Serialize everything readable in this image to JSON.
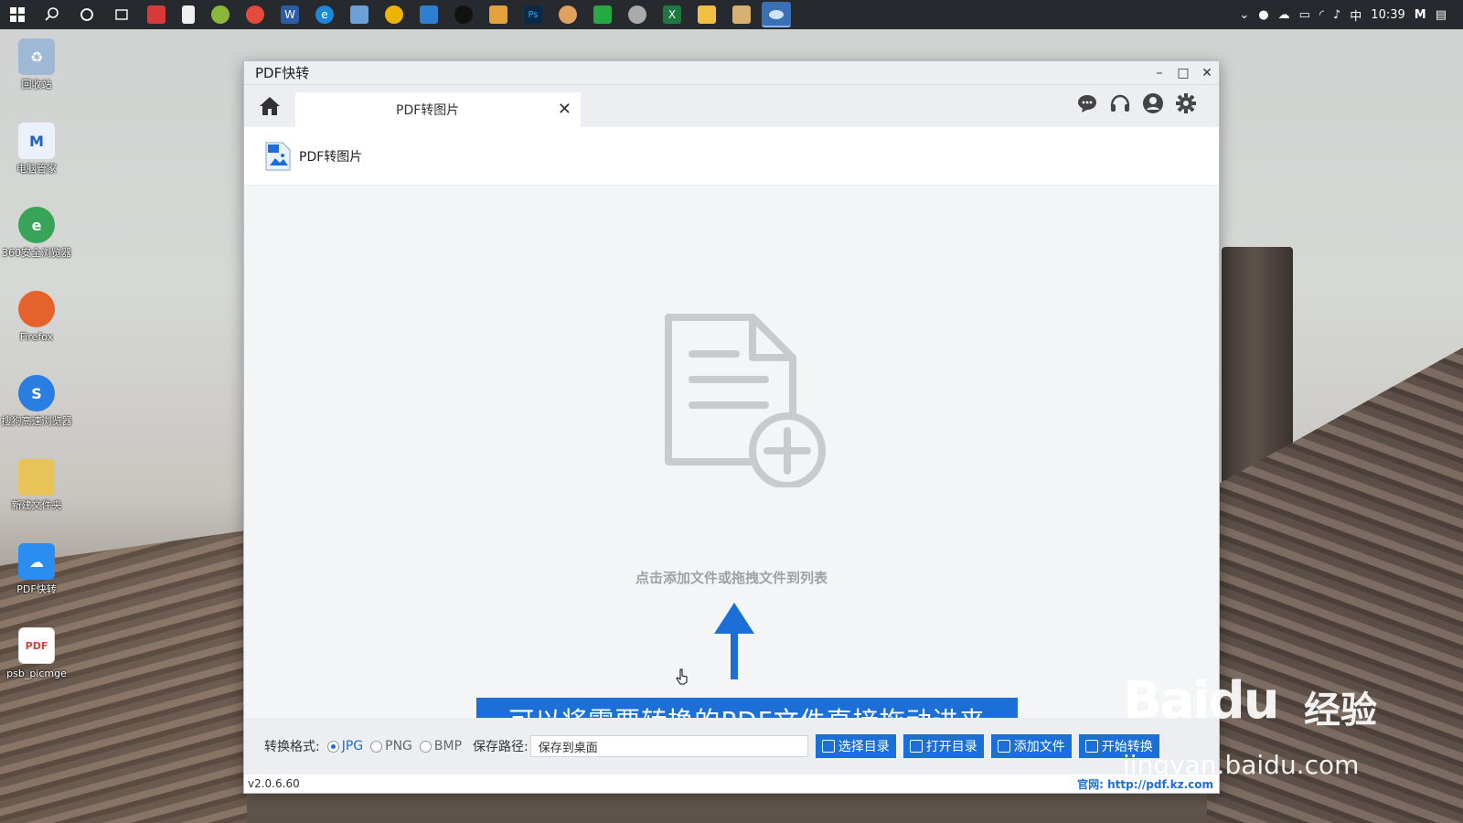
{
  "taskbar": {
    "time": "10:39",
    "ime": "中"
  },
  "desktop": {
    "icons": [
      {
        "label": "回收站",
        "icon": "recycle-bin-icon",
        "color": "#7aa6d8"
      },
      {
        "label": "电脑管家",
        "icon": "pc-manager-icon",
        "color": "#1e63c8"
      },
      {
        "label": "360安全浏览器",
        "icon": "browser-360-icon",
        "color": "#3aa35a"
      },
      {
        "label": "Firefox",
        "icon": "firefox-icon",
        "color": "#e6622c"
      },
      {
        "label": "搜狗高速浏览器",
        "icon": "sogou-browser-icon",
        "color": "#2a7de1"
      },
      {
        "label": "新建文件夹",
        "icon": "folder-icon",
        "color": "#e7c35a"
      },
      {
        "label": "PDF快转",
        "icon": "pdf-kuaizhuan-icon",
        "color": "#2b8df0"
      },
      {
        "label": "psb_picmge",
        "icon": "pdf-file-icon",
        "color": "#e53935"
      }
    ]
  },
  "window": {
    "title": "PDF快转",
    "tab_label": "PDF转图片",
    "section_title": "PDF转图片",
    "drop_hint": "点击添加文件或拖拽文件到列表",
    "banner": "可以将需要转换的PDF文件直接拖动进来",
    "format_label": "转换格式:",
    "formats": [
      "JPG",
      "PNG",
      "BMP"
    ],
    "selected_format": "JPG",
    "path_label": "保存路径:",
    "path_value": "保存到桌面",
    "buttons": {
      "choose_dir": "选择目录",
      "open_dir": "打开目录",
      "add_file": "添加文件",
      "convert": "开始转换"
    },
    "version": "v2.0.6.60",
    "site_label": "官网:",
    "site_url": "http://pdf.kz.com"
  },
  "watermark": {
    "logo": "Baidu",
    "cn": "经验",
    "url": "jingyan.baidu.com"
  },
  "colors": {
    "accent": "#1b6fd6",
    "taskbar": "#26292e"
  }
}
